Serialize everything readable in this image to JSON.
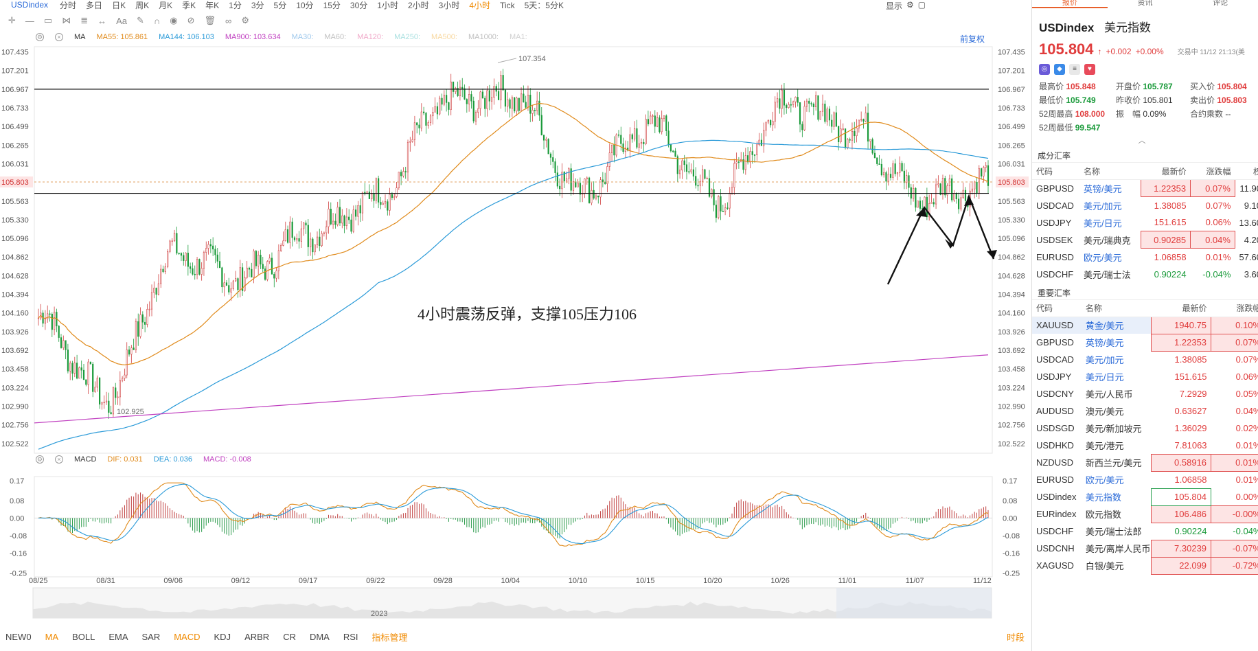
{
  "toolbar": {
    "symbol": "USDindex",
    "timeframes": [
      "分时",
      "多日",
      "日K",
      "周K",
      "月K",
      "季K",
      "年K",
      "1分",
      "3分",
      "5分",
      "10分",
      "15分",
      "30分",
      "1小时",
      "2小时",
      "3小时",
      "4小时",
      "Tick",
      "5天：5分K"
    ],
    "active_timeframe": "4小时",
    "display_label": "显示"
  },
  "chart": {
    "restore_label": "前复权",
    "ma_legend": [
      {
        "label": "MA",
        "color": "#333333"
      },
      {
        "label": "MA55:",
        "value": "105.861",
        "color": "#e08a1a"
      },
      {
        "label": "MA144:",
        "value": "106.103",
        "color": "#2a9ad8"
      },
      {
        "label": "MA900:",
        "value": "103.634",
        "color": "#c040c0"
      },
      {
        "label": "MA30:",
        "value": "",
        "color": "#9ec8ec"
      },
      {
        "label": "MA60:",
        "value": "",
        "color": "#c0c0c0"
      },
      {
        "label": "MA120:",
        "value": "",
        "color": "#f0a8c8"
      },
      {
        "label": "MA250:",
        "value": "",
        "color": "#a8e0e0"
      },
      {
        "label": "MA500:",
        "value": "",
        "color": "#f8d8a0"
      },
      {
        "label": "MA1000:",
        "value": "",
        "color": "#c0c0c0"
      },
      {
        "label": "MA1:",
        "value": "",
        "color": "#d0d0d0"
      }
    ],
    "macd_legend": [
      {
        "label": "MACD",
        "value": "",
        "color": "#333333"
      },
      {
        "label": "DIF:",
        "value": "0.031",
        "color": "#e08a1a"
      },
      {
        "label": "DEA:",
        "value": "0.036",
        "color": "#2a9ad8"
      },
      {
        "label": "MACD:",
        "value": "-0.008",
        "color": "#c040c0"
      }
    ],
    "annotation": "4小时震荡反弹，支撑105压力106",
    "high_label": "107.354",
    "low_label": "102.925",
    "current_price_tag": "105.803",
    "navigator_year": "2023",
    "price_axis": [
      "107.435",
      "107.201",
      "106.967",
      "106.733",
      "106.499",
      "106.265",
      "106.031",
      "105.797",
      "105.563",
      "105.330",
      "105.096",
      "104.862",
      "104.628",
      "104.394",
      "104.160",
      "103.926",
      "103.692",
      "103.458",
      "103.224",
      "102.990",
      "102.756",
      "102.522"
    ],
    "macd_axis": [
      "0.17",
      "0.08",
      "0.00",
      "-0.08",
      "-0.16",
      "-0.25"
    ],
    "dates": [
      "08/25",
      "08/31",
      "09/06",
      "09/12",
      "09/17",
      "09/22",
      "09/28",
      "10/04",
      "10/10",
      "10/15",
      "10/20",
      "10/26",
      "11/01",
      "11/07",
      "11/12"
    ]
  },
  "chart_data": {
    "type": "candlestick",
    "title": "",
    "x": [
      "08/25",
      "08/31",
      "09/06",
      "09/12",
      "09/17",
      "09/22",
      "09/28",
      "10/04",
      "10/10",
      "10/15",
      "10/20",
      "10/26",
      "11/01",
      "11/07",
      "11/12"
    ],
    "close_approx": [
      104.1,
      103.1,
      104.9,
      104.6,
      105.2,
      105.6,
      106.8,
      106.9,
      105.7,
      106.5,
      105.6,
      106.8,
      106.5,
      105.6,
      105.8
    ],
    "horizontal_lines": [
      106.967,
      105.66
    ],
    "ylim": [
      102.4,
      107.5
    ],
    "series": [
      {
        "name": "MA55",
        "last": 105.861
      },
      {
        "name": "MA144",
        "last": 106.103
      },
      {
        "name": "MA900",
        "last": 103.634
      }
    ],
    "macd": {
      "DIF": 0.031,
      "DEA": 0.036,
      "MACD": -0.008,
      "ylim": [
        -0.25,
        0.17
      ]
    }
  },
  "bottom_tabs": [
    "NEW0",
    "MA",
    "BOLL",
    "EMA",
    "SAR",
    "MACD",
    "KDJ",
    "ARBR",
    "CR",
    "DMA",
    "RSI",
    "指标管理"
  ],
  "bottom_time": "时段",
  "panel": {
    "tabs": [
      "报价",
      "资讯",
      "评论"
    ],
    "symbol": "USDindex",
    "symbol_cn": "美元指数",
    "price": "105.804",
    "arrow": "↑",
    "change": "+0.002",
    "change_pct": "+0.00%",
    "trade_time": "交易中 11/12 21:13(美",
    "stats": [
      [
        {
          "k": "最高价",
          "v": "105.848",
          "c": "r"
        },
        {
          "k": "开盘价",
          "v": "105.787",
          "c": "g"
        },
        {
          "k": "买入价",
          "v": "105.804",
          "c": "r"
        }
      ],
      [
        {
          "k": "最低价",
          "v": "105.749",
          "c": "g"
        },
        {
          "k": "昨收价",
          "v": "105.801",
          "c": "n"
        },
        {
          "k": "卖出价",
          "v": "105.803",
          "c": "r"
        }
      ],
      [
        {
          "k": "52周最高",
          "v": "108.000",
          "c": "r"
        },
        {
          "k": "振　幅",
          "v": "0.09%",
          "c": "n"
        },
        {
          "k": "合约乘数",
          "v": "--",
          "c": "n"
        }
      ],
      [
        {
          "k": "52周最低",
          "v": "99.547",
          "c": "g"
        },
        {
          "k": "",
          "v": "",
          "c": "n"
        },
        {
          "k": "",
          "v": "",
          "c": "n"
        }
      ]
    ],
    "section1": "成分汇率",
    "section1_headers": [
      "代码",
      "名称",
      "最新价",
      "涨跌幅",
      "权"
    ],
    "section1_rows": [
      {
        "code": "GBPUSD",
        "name": "英镑/美元",
        "price": "1.22353",
        "pct": "0.07%",
        "w": "11.90",
        "blue": true,
        "dir": "up",
        "box": true,
        "sel": false
      },
      {
        "code": "USDCAD",
        "name": "美元/加元",
        "price": "1.38085",
        "pct": "0.07%",
        "w": "9.10",
        "blue": true,
        "dir": "up",
        "box": false,
        "sel": false
      },
      {
        "code": "USDJPY",
        "name": "美元/日元",
        "price": "151.615",
        "pct": "0.06%",
        "w": "13.60",
        "blue": true,
        "dir": "up",
        "box": false,
        "sel": false
      },
      {
        "code": "USDSEK",
        "name": "美元/瑞典克",
        "price": "0.90285",
        "pct": "0.04%",
        "w": "4.20",
        "blue": false,
        "dir": "up",
        "box": true,
        "sel": false
      },
      {
        "code": "EURUSD",
        "name": "欧元/美元",
        "price": "1.06858",
        "pct": "0.01%",
        "w": "57.60",
        "blue": true,
        "dir": "up",
        "box": false,
        "sel": false
      },
      {
        "code": "USDCHF",
        "name": "美元/瑞士法",
        "price": "0.90224",
        "pct": "-0.04%",
        "w": "3.60",
        "blue": false,
        "dir": "dn",
        "box": false,
        "sel": false
      }
    ],
    "section2": "重要汇率",
    "section2_headers": [
      "代码",
      "名称",
      "最新价",
      "涨跌幅"
    ],
    "section2_rows": [
      {
        "code": "XAUUSD",
        "name": "黄金/美元",
        "price": "1940.75",
        "pct": "0.10%",
        "blue": true,
        "dir": "up",
        "box": true,
        "sel": true
      },
      {
        "code": "GBPUSD",
        "name": "英镑/美元",
        "price": "1.22353",
        "pct": "0.07%",
        "blue": true,
        "dir": "up",
        "box": true,
        "sel": false
      },
      {
        "code": "USDCAD",
        "name": "美元/加元",
        "price": "1.38085",
        "pct": "0.07%",
        "blue": true,
        "dir": "up",
        "box": false,
        "sel": false
      },
      {
        "code": "USDJPY",
        "name": "美元/日元",
        "price": "151.615",
        "pct": "0.06%",
        "blue": true,
        "dir": "up",
        "box": false,
        "sel": false
      },
      {
        "code": "USDCNY",
        "name": "美元/人民币",
        "price": "7.2929",
        "pct": "0.05%",
        "blue": false,
        "dir": "up",
        "box": false,
        "sel": false
      },
      {
        "code": "AUDUSD",
        "name": "澳元/美元",
        "price": "0.63627",
        "pct": "0.04%",
        "blue": false,
        "dir": "up",
        "box": false,
        "sel": false
      },
      {
        "code": "USDSGD",
        "name": "美元/新加坡元",
        "price": "1.36029",
        "pct": "0.02%",
        "blue": false,
        "dir": "up",
        "box": false,
        "sel": false
      },
      {
        "code": "USDHKD",
        "name": "美元/港元",
        "price": "7.81063",
        "pct": "0.01%",
        "blue": false,
        "dir": "up",
        "box": false,
        "sel": false
      },
      {
        "code": "NZDUSD",
        "name": "新西兰元/美元",
        "price": "0.58916",
        "pct": "0.01%",
        "blue": false,
        "dir": "up",
        "box": true,
        "sel": false
      },
      {
        "code": "EURUSD",
        "name": "欧元/美元",
        "price": "1.06858",
        "pct": "0.01%",
        "blue": true,
        "dir": "up",
        "box": false,
        "sel": false
      },
      {
        "code": "USDindex",
        "name": "美元指数",
        "price": "105.804",
        "pct": "0.00%",
        "blue": true,
        "dir": "up",
        "box": "g",
        "sel": false
      },
      {
        "code": "EURindex",
        "name": "欧元指数",
        "price": "106.486",
        "pct": "-0.00%",
        "blue": false,
        "dir": "up",
        "box": true,
        "sel": false
      },
      {
        "code": "USDCHF",
        "name": "美元/瑞士法郎",
        "price": "0.90224",
        "pct": "-0.04%",
        "blue": false,
        "dir": "dn",
        "box": false,
        "sel": false
      },
      {
        "code": "USDCNH",
        "name": "美元/离岸人民币",
        "price": "7.30239",
        "pct": "-0.07%",
        "blue": false,
        "dir": "up",
        "box": true,
        "sel": false
      },
      {
        "code": "XAGUSD",
        "name": "白银/美元",
        "price": "22.099",
        "pct": "-0.72%",
        "blue": false,
        "dir": "up",
        "box": true,
        "sel": false
      }
    ]
  }
}
